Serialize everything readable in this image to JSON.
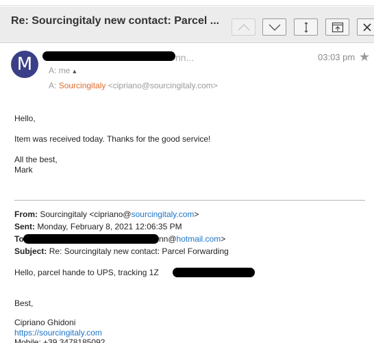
{
  "header": {
    "subject": "Re: Sourcingitaly new contact: Parcel ...",
    "buttons": {
      "up": "chevron-up-icon",
      "down": "chevron-down-icon",
      "expand": "expand-vertical-icon",
      "popout": "popout-icon",
      "close": "close-icon"
    }
  },
  "message": {
    "avatar_letter": "M",
    "sender_suffix": "nn...",
    "time": "03:03 pm",
    "star": "★",
    "to_prefix": "A:",
    "to_me": "me",
    "to_caret": "▲",
    "cc_prefix": "A:",
    "cc_name": "Sourcingitaly",
    "cc_email": "<cipriano@sourcingitaly.com>",
    "avatar_color": "#3a3f87",
    "accent_color": "#e06a2c",
    "link_color": "#1a73c8"
  },
  "body": {
    "greeting": "Hello,",
    "line1": "Item was received today.  Thanks for the good service!",
    "signoff1": "All the best,",
    "signoff2": "Mark"
  },
  "forwarded": {
    "from_label": "From:",
    "from_name": "Sourcingitaly <cipriano@",
    "from_domain": "sourcingitaly.com",
    "from_end": ">",
    "sent_label": "Sent:",
    "sent_value": "Monday, February 8, 2021 12:06:35 PM",
    "to_label": "To:",
    "to_suffix": "nn@",
    "to_domain": "hotmail.com",
    "to_end": ">",
    "subject_label": "Subject:",
    "subject_value": "Re: Sourcingitaly new contact: Parcel Forwarding",
    "line1": "Hello, parcel hande to UPS, tracking 1Z",
    "best": "Best,",
    "sig_name": "Cipriano Ghidoni",
    "sig_url": "https://sourcingitaly.com",
    "sig_mobile": "Mobile: +39 3478185092"
  }
}
